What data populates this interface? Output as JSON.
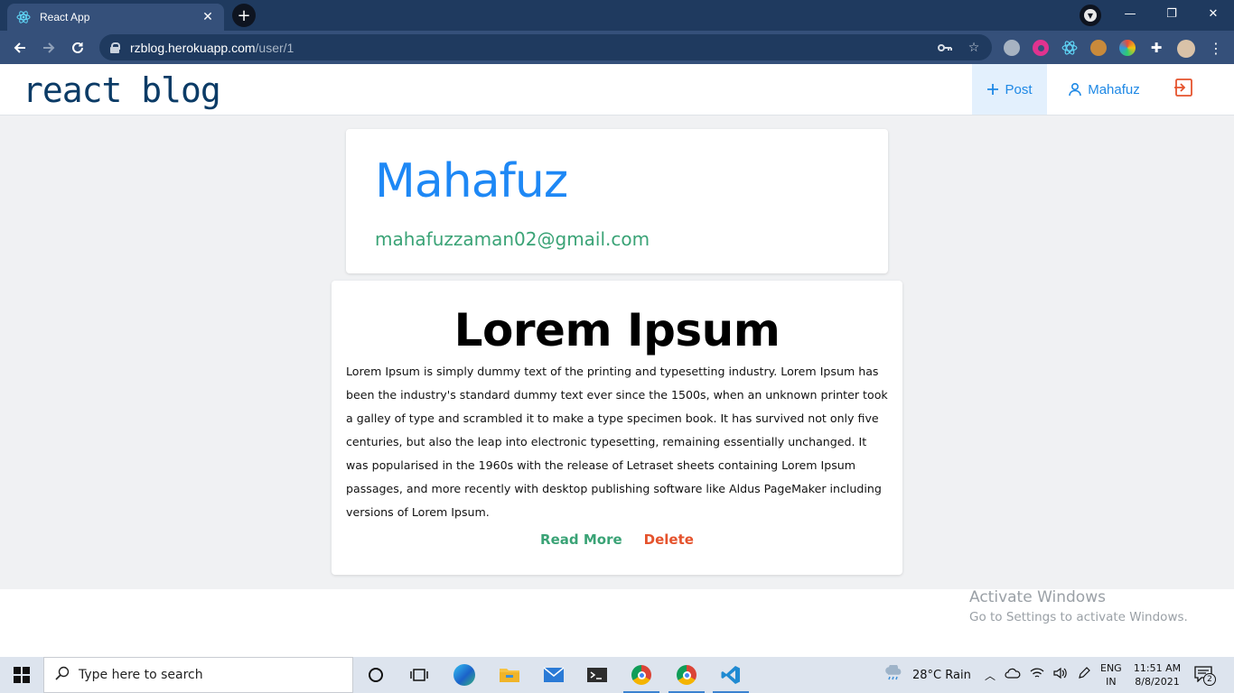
{
  "browser": {
    "tab_title": "React App",
    "tab_close": "✕",
    "new_tab": "+",
    "url_host": "rzblog.herokuapp.com",
    "url_path": "/user/1",
    "window_controls": [
      "—",
      "❐",
      "✕"
    ]
  },
  "header": {
    "brand": "react blog",
    "post_label": "Post",
    "user_label": "Mahafuz"
  },
  "profile": {
    "name": "Mahafuz",
    "email": "mahafuzzaman02@gmail.com"
  },
  "post": {
    "title": "Lorem Ipsum",
    "body": "Lorem Ipsum is simply dummy text of the printing and typesetting industry. Lorem Ipsum has been the industry's standard dummy text ever since the 1500s, when an unknown printer took a galley of type and scrambled it to make a type specimen book. It has survived not only five centuries, but also the leap into electronic typesetting, remaining essentially unchanged. It was popularised in the 1960s with the release of Letraset sheets containing Lorem Ipsum passages, and more recently with desktop publishing software like Aldus PageMaker including versions of Lorem Ipsum.",
    "read_more": "Read More",
    "delete": "Delete"
  },
  "watermark": {
    "line1": "Activate Windows",
    "line2": "Go to Settings to activate Windows."
  },
  "taskbar": {
    "search_placeholder": "Type here to search",
    "weather": "28°C  Rain",
    "lang_line1": "ENG",
    "lang_line2": "IN",
    "time": "11:51 AM",
    "date": "8/8/2021",
    "notifications": "2"
  },
  "colors": {
    "accent_blue": "#1e88f5",
    "email_green": "#3aa376",
    "delete_red": "#e5532d",
    "brand_navy": "#0b3b66"
  }
}
